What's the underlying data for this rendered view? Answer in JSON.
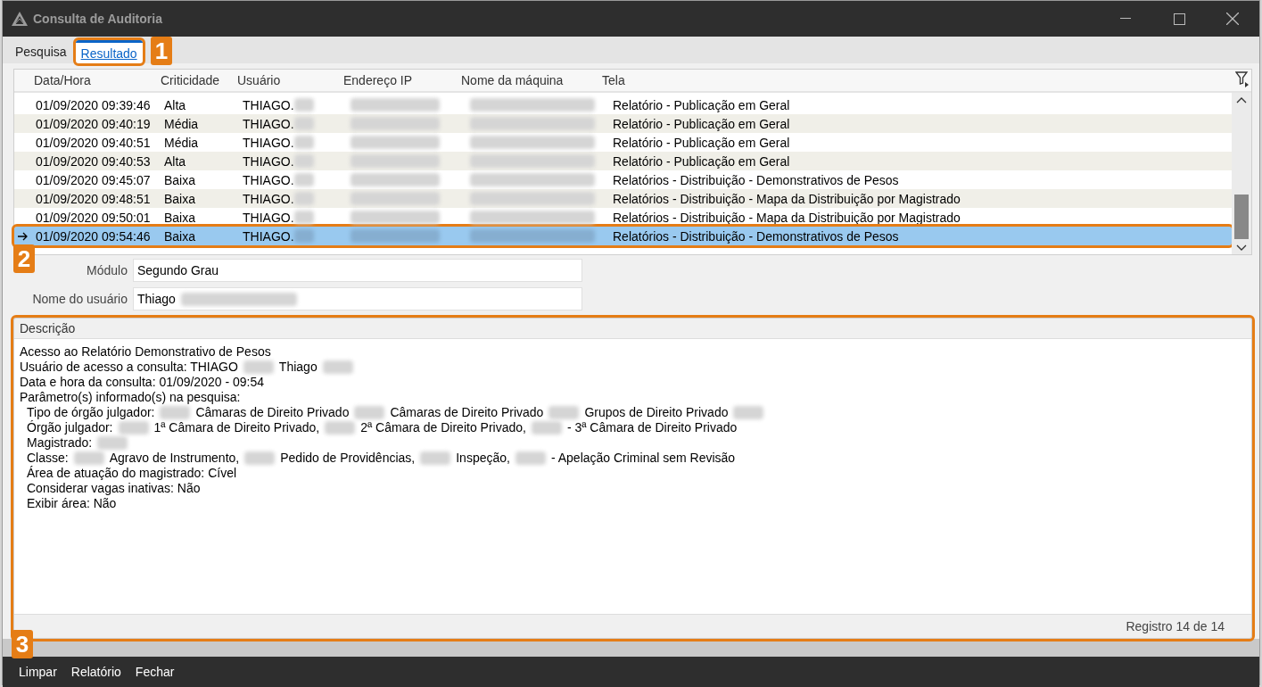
{
  "window": {
    "title": "Consulta de Auditoria"
  },
  "tabs": [
    {
      "label": "Pesquisa",
      "selected": false
    },
    {
      "label": "Resultado",
      "selected": true,
      "callout": "1"
    }
  ],
  "table": {
    "columns": [
      "Data/Hora",
      "Criticidade",
      "Usuário",
      "Endereço IP",
      "Nome da máquina",
      "Tela"
    ],
    "rows": [
      {
        "datetime": "01/09/2020 09:39:46",
        "criticality": "Alta",
        "user": "THIAGO.",
        "screen": "Relatório - Publicação em Geral",
        "selected": false
      },
      {
        "datetime": "01/09/2020 09:40:19",
        "criticality": "Média",
        "user": "THIAGO.",
        "screen": "Relatório - Publicação em Geral",
        "selected": false
      },
      {
        "datetime": "01/09/2020 09:40:51",
        "criticality": "Média",
        "user": "THIAGO.",
        "screen": "Relatório - Publicação em Geral",
        "selected": false
      },
      {
        "datetime": "01/09/2020 09:40:53",
        "criticality": "Alta",
        "user": "THIAGO.",
        "screen": "Relatório - Publicação em Geral",
        "selected": false
      },
      {
        "datetime": "01/09/2020 09:45:07",
        "criticality": "Baixa",
        "user": "THIAGO.",
        "screen": "Relatórios - Distribuição - Demonstrativos de Pesos",
        "selected": false
      },
      {
        "datetime": "01/09/2020 09:48:51",
        "criticality": "Baixa",
        "user": "THIAGO.",
        "screen": "Relatórios - Distribuição - Mapa da Distribuição por Magistrado",
        "selected": false
      },
      {
        "datetime": "01/09/2020 09:50:01",
        "criticality": "Baixa",
        "user": "THIAGO.",
        "screen": "Relatórios - Distribuição - Mapa da Distribuição por Magistrado",
        "selected": false
      },
      {
        "datetime": "01/09/2020 09:54:46",
        "criticality": "Baixa",
        "user": "THIAGO.",
        "screen": "Relatórios - Distribuição - Demonstrativos de Pesos",
        "selected": true,
        "callout": "2"
      }
    ]
  },
  "fields": [
    {
      "label": "Módulo",
      "value": "Segundo Grau",
      "redacted": false
    },
    {
      "label": "Nome do usuário",
      "value": "Thiago",
      "redacted": true
    }
  ],
  "description": {
    "title": "Descrição",
    "lines": [
      {
        "parts": [
          "Acesso ao Relatório  Demonstrativo de Pesos"
        ]
      },
      {
        "parts": [
          "Usuário de acesso a consulta: THIAGO",
          {
            "kind": "redacted"
          },
          "Thiago",
          {
            "kind": "redacted"
          }
        ]
      },
      {
        "parts": [
          "Data e hora da consulta: 01/09/2020 - 09:54"
        ]
      },
      {
        "parts": [
          "Parâmetro(s) informado(s) na pesquisa:"
        ],
        "children": [
          {
            "parts": [
              "Tipo de órgão julgador:",
              {
                "kind": "redacted"
              },
              "Câmaras de Direito Privado",
              {
                "kind": "redacted"
              },
              "Câmaras de Direito Privado",
              {
                "kind": "redacted"
              },
              "Grupos de Direito Privado",
              {
                "kind": "redacted"
              }
            ]
          },
          {
            "parts": [
              "Órgão julgador:",
              {
                "kind": "redacted"
              },
              "1ª Câmara de Direito Privado,",
              {
                "kind": "redacted"
              },
              "2ª Câmara de Direito Privado,",
              {
                "kind": "redacted"
              },
              "- 3ª Câmara de Direito Privado"
            ]
          },
          {
            "parts": [
              "Magistrado:",
              {
                "kind": "redacted"
              }
            ]
          },
          {
            "parts": [
              "Classe:",
              {
                "kind": "redacted"
              },
              "Agravo de Instrumento,",
              {
                "kind": "redacted"
              },
              "Pedido de Providências,",
              {
                "kind": "redacted"
              },
              "Inspeção,",
              {
                "kind": "redacted"
              },
              "- Apelação Criminal sem Revisão"
            ]
          },
          {
            "parts": [
              "Área de atuação do magistrado: Cível"
            ]
          },
          {
            "parts": [
              "Considerar vagas inativas: Não"
            ]
          },
          {
            "parts": [
              "Exibir área: Não"
            ]
          }
        ]
      }
    ],
    "footer": "Registro 14 de 14",
    "callout": "3"
  },
  "buttons": [
    "Limpar",
    "Relatório",
    "Fechar"
  ]
}
